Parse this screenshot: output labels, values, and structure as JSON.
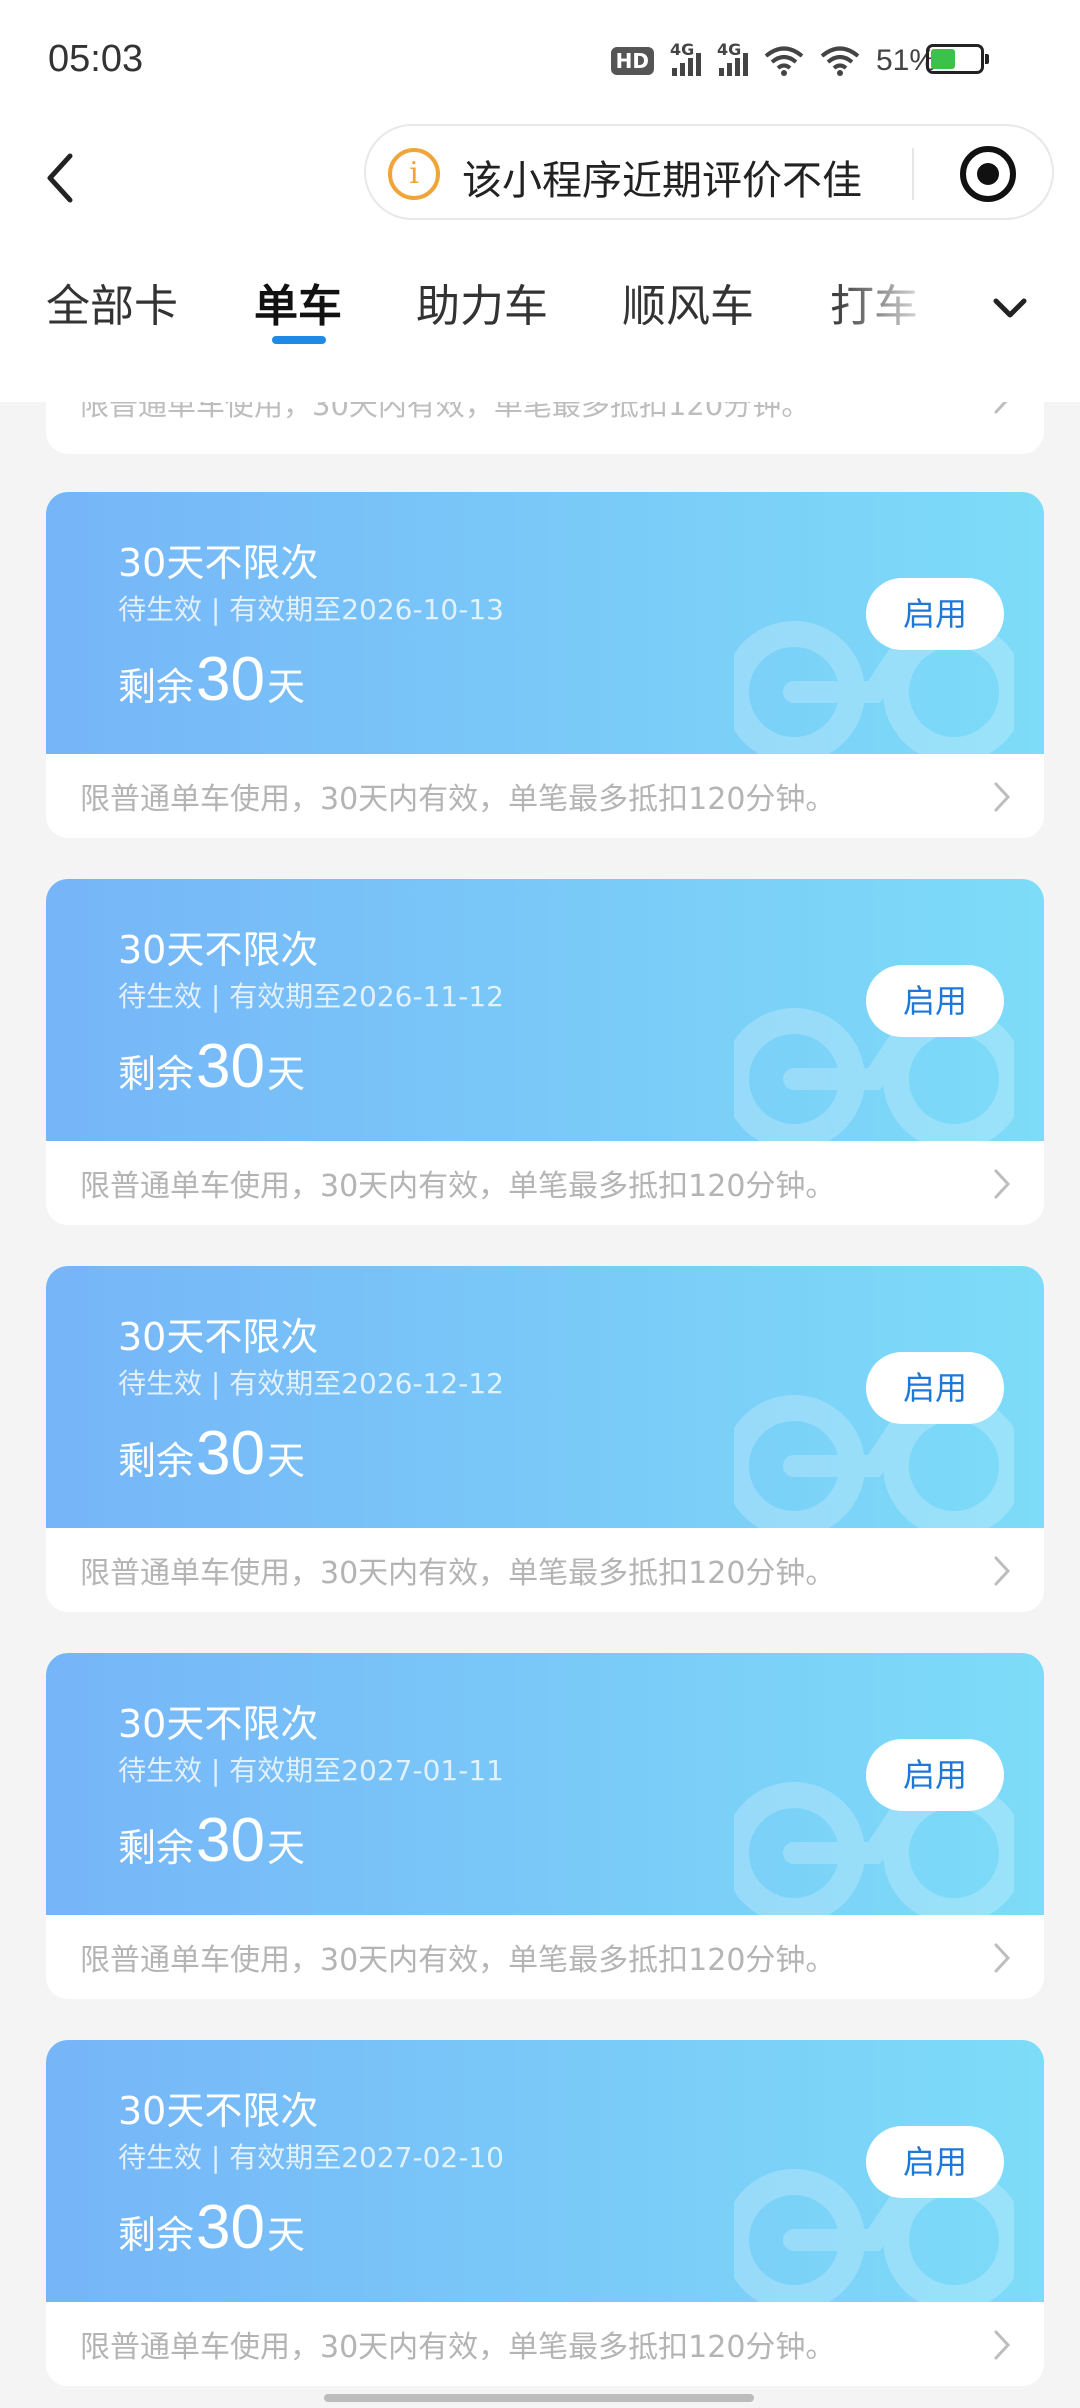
{
  "status_bar": {
    "time": "05:03",
    "hd_label": "HD",
    "signal1_label": "4G",
    "signal2_label": "4G",
    "battery_percent": "51%",
    "battery_level": 0.51
  },
  "header": {
    "notice_text": "该小程序近期评价不佳",
    "info_symbol": "i"
  },
  "tabs": {
    "items": [
      {
        "label": "全部卡"
      },
      {
        "label": "单车"
      },
      {
        "label": "助力车"
      },
      {
        "label": "顺风车"
      },
      {
        "label": "打车"
      }
    ],
    "active_index": 1
  },
  "partial_card": {
    "rule": "限普通单车使用，30天内有效，单笔最多抵扣120分钟。"
  },
  "cards": [
    {
      "title": "30天不限次",
      "subtitle": "待生效 | 有效期至2026-10-13",
      "remaining_prefix": "剩余",
      "remaining_value": "30",
      "remaining_unit": "天",
      "button": "启用",
      "rule": "限普通单车使用，30天内有效，单笔最多抵扣120分钟。"
    },
    {
      "title": "30天不限次",
      "subtitle": "待生效 | 有效期至2026-11-12",
      "remaining_prefix": "剩余",
      "remaining_value": "30",
      "remaining_unit": "天",
      "button": "启用",
      "rule": "限普通单车使用，30天内有效，单笔最多抵扣120分钟。"
    },
    {
      "title": "30天不限次",
      "subtitle": "待生效 | 有效期至2026-12-12",
      "remaining_prefix": "剩余",
      "remaining_value": "30",
      "remaining_unit": "天",
      "button": "启用",
      "rule": "限普通单车使用，30天内有效，单笔最多抵扣120分钟。"
    },
    {
      "title": "30天不限次",
      "subtitle": "待生效 | 有效期至2027-01-11",
      "remaining_prefix": "剩余",
      "remaining_value": "30",
      "remaining_unit": "天",
      "button": "启用",
      "rule": "限普通单车使用，30天内有效，单笔最多抵扣120分钟。"
    },
    {
      "title": "30天不限次",
      "subtitle": "待生效 | 有效期至2027-02-10",
      "remaining_prefix": "剩余",
      "remaining_value": "30",
      "remaining_unit": "天",
      "button": "启用",
      "rule": "限普通单车使用，30天内有效，单笔最多抵扣120分钟。"
    }
  ],
  "colors": {
    "card_gradient_start": "#76b5f8",
    "card_gradient_end": "#7ddcf8",
    "active_tab_underline": "#1f8ae6",
    "button_text": "#1e78d8",
    "notice_icon": "#f0a43a"
  },
  "icons": {
    "back": "chevron-left-icon",
    "info": "info-circle-icon",
    "target": "target-icon",
    "more_tabs": "chevron-down-icon",
    "card_watermark": "bike-icon",
    "card_arrow": "chevron-right-icon"
  }
}
